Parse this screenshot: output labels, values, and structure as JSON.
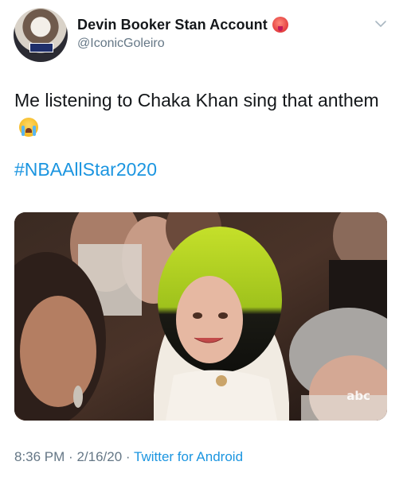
{
  "author": {
    "display_name": "Devin Booker Stan Account",
    "handle": "@IconicGoleiro",
    "avatar_icon": "profile-avatar",
    "name_emoji_icon": "flushed-face-emoji"
  },
  "tweet": {
    "text": "Me listening to Chaka Khan sing that anthem",
    "text_emoji_icon": "loudly-crying-face-emoji",
    "hashtag": "#NBAAllStar2020"
  },
  "media": {
    "watermark": "abc"
  },
  "meta": {
    "time": "8:36 PM",
    "separator": "·",
    "date": "2/16/20",
    "client": "Twitter for Android"
  },
  "colors": {
    "link": "#1b95e0",
    "secondary_text": "#657786",
    "primary_text": "#14171a"
  }
}
